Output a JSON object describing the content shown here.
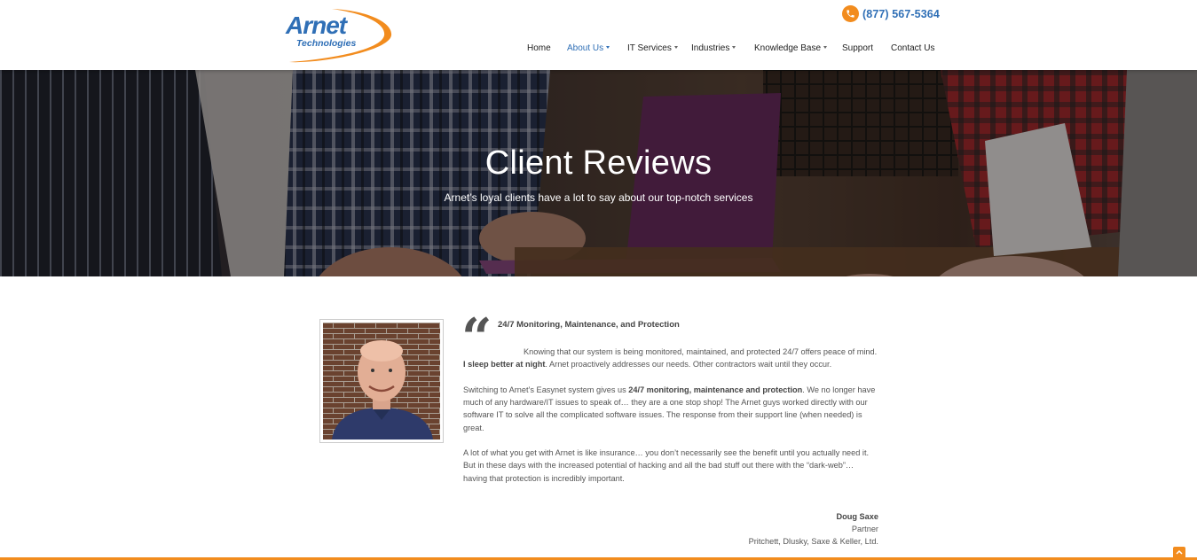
{
  "brand": {
    "logo_line1": "Arnet",
    "logo_line2": "Technologies",
    "accent_color": "#f28c1e",
    "link_color": "#2f6fb6"
  },
  "header": {
    "phone_icon": "phone-icon",
    "phone": "(877) 567-5364"
  },
  "nav": {
    "items": [
      {
        "label": "Home"
      },
      {
        "label": "About Us"
      },
      {
        "label": "IT Services"
      },
      {
        "label": "Industries"
      },
      {
        "label": "Knowledge Base"
      },
      {
        "label": "Support"
      },
      {
        "label": "Contact Us"
      }
    ]
  },
  "hero": {
    "title": "Client Reviews",
    "subtitle": "Arnet’s loyal clients have a lot to say about our top-notch services"
  },
  "testimonial": {
    "quote_icon": "quote-icon",
    "title": "24/7 Monitoring, Maintenance, and Protection",
    "p1_a": "Knowing that our system is being monitored, maintained, and protected 24/7 offers peace of mind. ",
    "p1_bold": "I sleep better at night",
    "p1_b": ". Arnet proactively addresses our needs. Other contractors wait until they occur.",
    "p2_a": "Switching to Arnet’s Easynet system gives us ",
    "p2_bold": "24/7 monitoring, maintenance and protection",
    "p2_b": ". We no longer have much of any hardware/IT issues to speak of… they are a one stop shop! The Arnet guys worked directly with our software IT to solve all the complicated software issues. The response from their support line (when needed) is great.",
    "p3": "A lot of what you get with Arnet is like insurance… you don’t necessarily see the benefit until you actually need it. But in these days with the increased potential of hacking and all the bad stuff out there with the “dark-web”… having that protection is incredibly important.",
    "author_name": "Doug Saxe",
    "author_role": "Partner",
    "author_company": "Pritchett, Dlusky, Saxe & Keller, Ltd."
  },
  "scroll_top_icon": "chevron-up-icon"
}
